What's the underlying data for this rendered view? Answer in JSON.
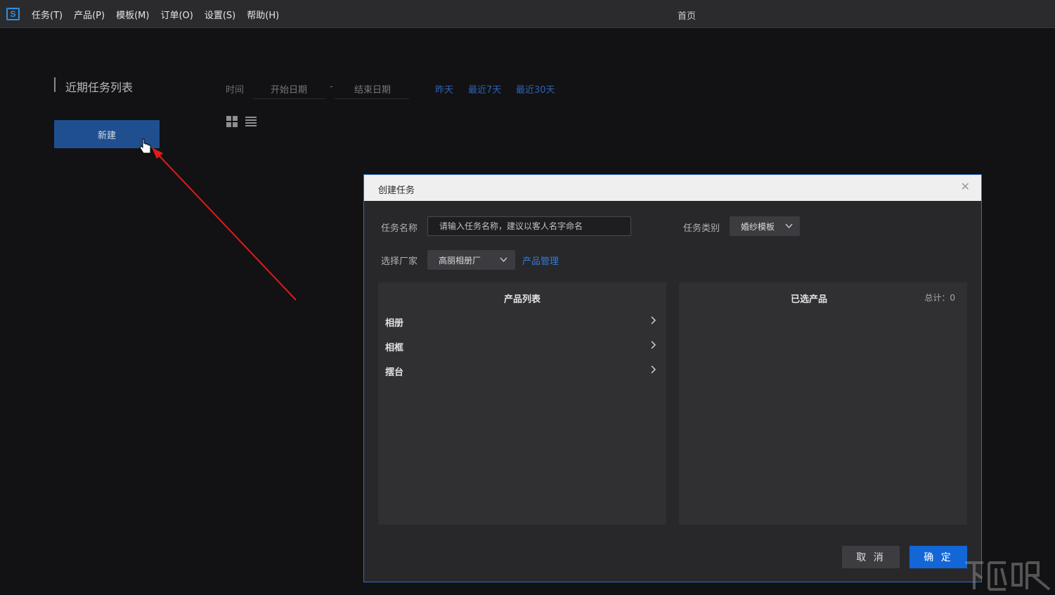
{
  "menubar": {
    "logo": "S",
    "items": [
      {
        "label": "任务(T)"
      },
      {
        "label": "产品(P)"
      },
      {
        "label": "模板(M)"
      },
      {
        "label": "订单(O)"
      },
      {
        "label": "设置(S)"
      },
      {
        "label": "帮助(H)"
      }
    ],
    "window_title": "首页"
  },
  "sidebar": {
    "section_title": "近期任务列表",
    "new_button_label": "新建"
  },
  "filter": {
    "time_label": "时间",
    "start_date_placeholder": "开始日期",
    "separator": "-",
    "end_date_placeholder": "结束日期",
    "quick_links": [
      "昨天",
      "最近7天",
      "最近30天"
    ]
  },
  "view_toggle": {
    "icons": [
      "grid-view-icon",
      "list-view-icon"
    ]
  },
  "dialog": {
    "title": "创建任务",
    "close_icon": "close-icon",
    "task_name_label": "任务名称",
    "task_name_placeholder": "请输入任务名称，建议以客人名字命名",
    "task_type_label": "任务类别",
    "task_type_value": "婚纱模板",
    "vendor_label": "选择厂家",
    "vendor_value": "高丽相册厂",
    "product_manage_link": "产品管理",
    "product_list_title": "产品列表",
    "products": [
      {
        "label": "相册"
      },
      {
        "label": "相框"
      },
      {
        "label": "摆台"
      }
    ],
    "selected_title": "已选产品",
    "selected_total": "总计：0",
    "cancel_label": "取 消",
    "ok_label": "确 定"
  },
  "colors": {
    "accent": "#1366d6",
    "link": "#2f7be0",
    "annotation_arrow": "#e11a1a"
  }
}
